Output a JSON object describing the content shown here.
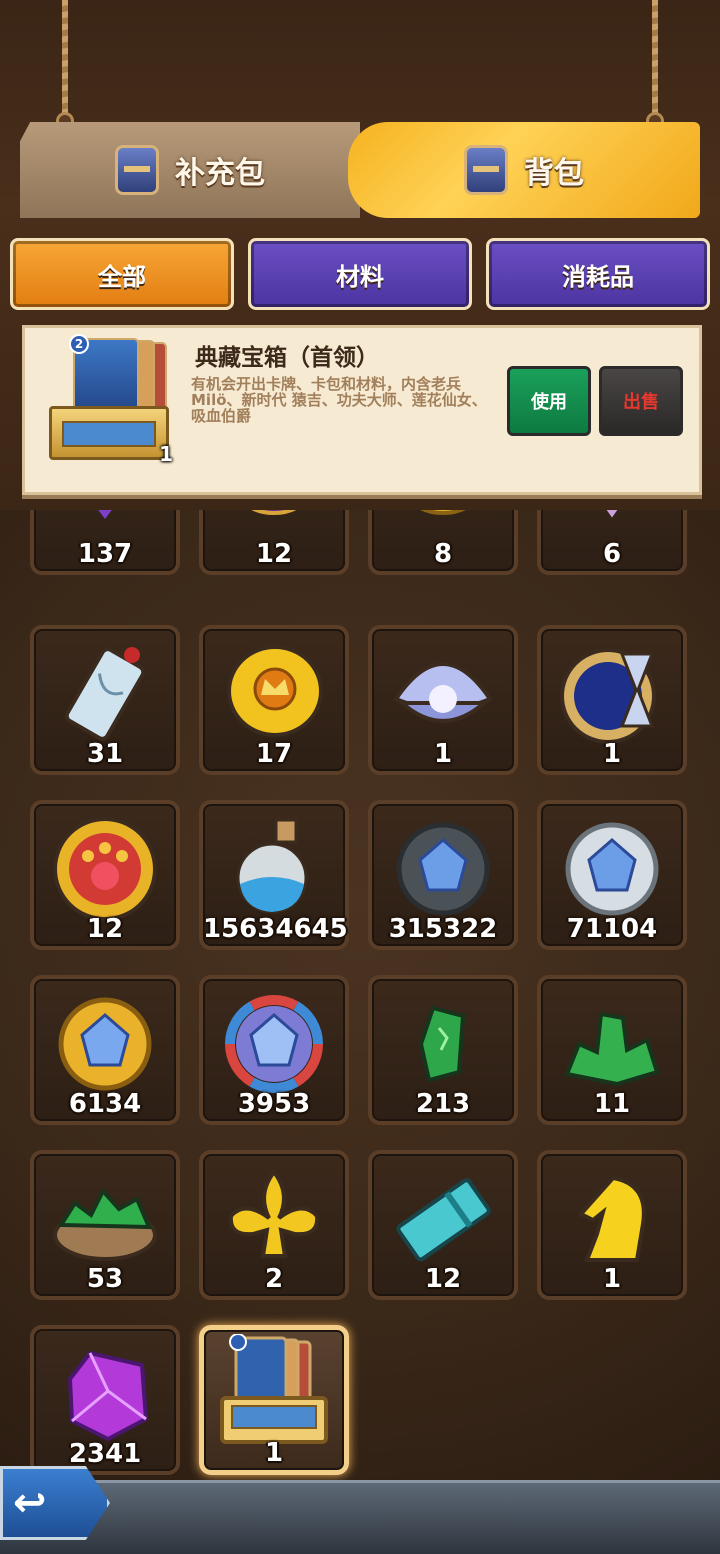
{
  "main_tabs": [
    {
      "label": "补充包",
      "active": false
    },
    {
      "label": "背包",
      "active": true
    }
  ],
  "sub_tabs": [
    {
      "label": "全部",
      "active": true
    },
    {
      "label": "材料",
      "active": false
    },
    {
      "label": "消耗品",
      "active": false
    }
  ],
  "detail": {
    "title": "典藏宝箱（首领）",
    "description": "有机会开出卡牌、卡包和材料，内含老兵Milö、新时代 猿吉、功夫大师、莲花仙女、吸血伯爵",
    "count": "1",
    "card_level": "2",
    "use_label": "使用",
    "sell_label": "出售"
  },
  "partial_row": [
    "137",
    "12",
    "8",
    "6"
  ],
  "items": [
    {
      "icon": "talisman-card-icon",
      "count": "31"
    },
    {
      "icon": "gold-crown-coin-icon",
      "count": "17"
    },
    {
      "icon": "pearl-shell-icon",
      "count": "1"
    },
    {
      "icon": "hourglass-clock-icon",
      "count": "1"
    },
    {
      "icon": "paw-ruby-coin-icon",
      "count": "12"
    },
    {
      "icon": "blue-sand-bottle-icon",
      "count": "15634645"
    },
    {
      "icon": "dark-gem-orb-icon",
      "count": "315322"
    },
    {
      "icon": "silver-gem-orb-icon",
      "count": "71104"
    },
    {
      "icon": "gold-gem-orb-icon",
      "count": "6134"
    },
    {
      "icon": "rainbow-gem-orb-icon",
      "count": "3953"
    },
    {
      "icon": "green-crystal-icon",
      "count": "213"
    },
    {
      "icon": "green-crystal-pile-icon",
      "count": "11"
    },
    {
      "icon": "green-crystal-sack-icon",
      "count": "53"
    },
    {
      "icon": "gold-fleur-icon",
      "count": "2"
    },
    {
      "icon": "blue-ticket-icon",
      "count": "12"
    },
    {
      "icon": "gold-knight-icon",
      "count": "1"
    },
    {
      "icon": "purple-crystal-icon",
      "count": "2341"
    },
    {
      "icon": "treasure-chest-icon",
      "count": "1"
    }
  ],
  "colors": {
    "active_tab": "#f5b21f",
    "sub_active": "#f7a736",
    "sub_inactive": "#5a40b4",
    "use_button": "#1aa05a",
    "sell_text": "#e6382f"
  }
}
